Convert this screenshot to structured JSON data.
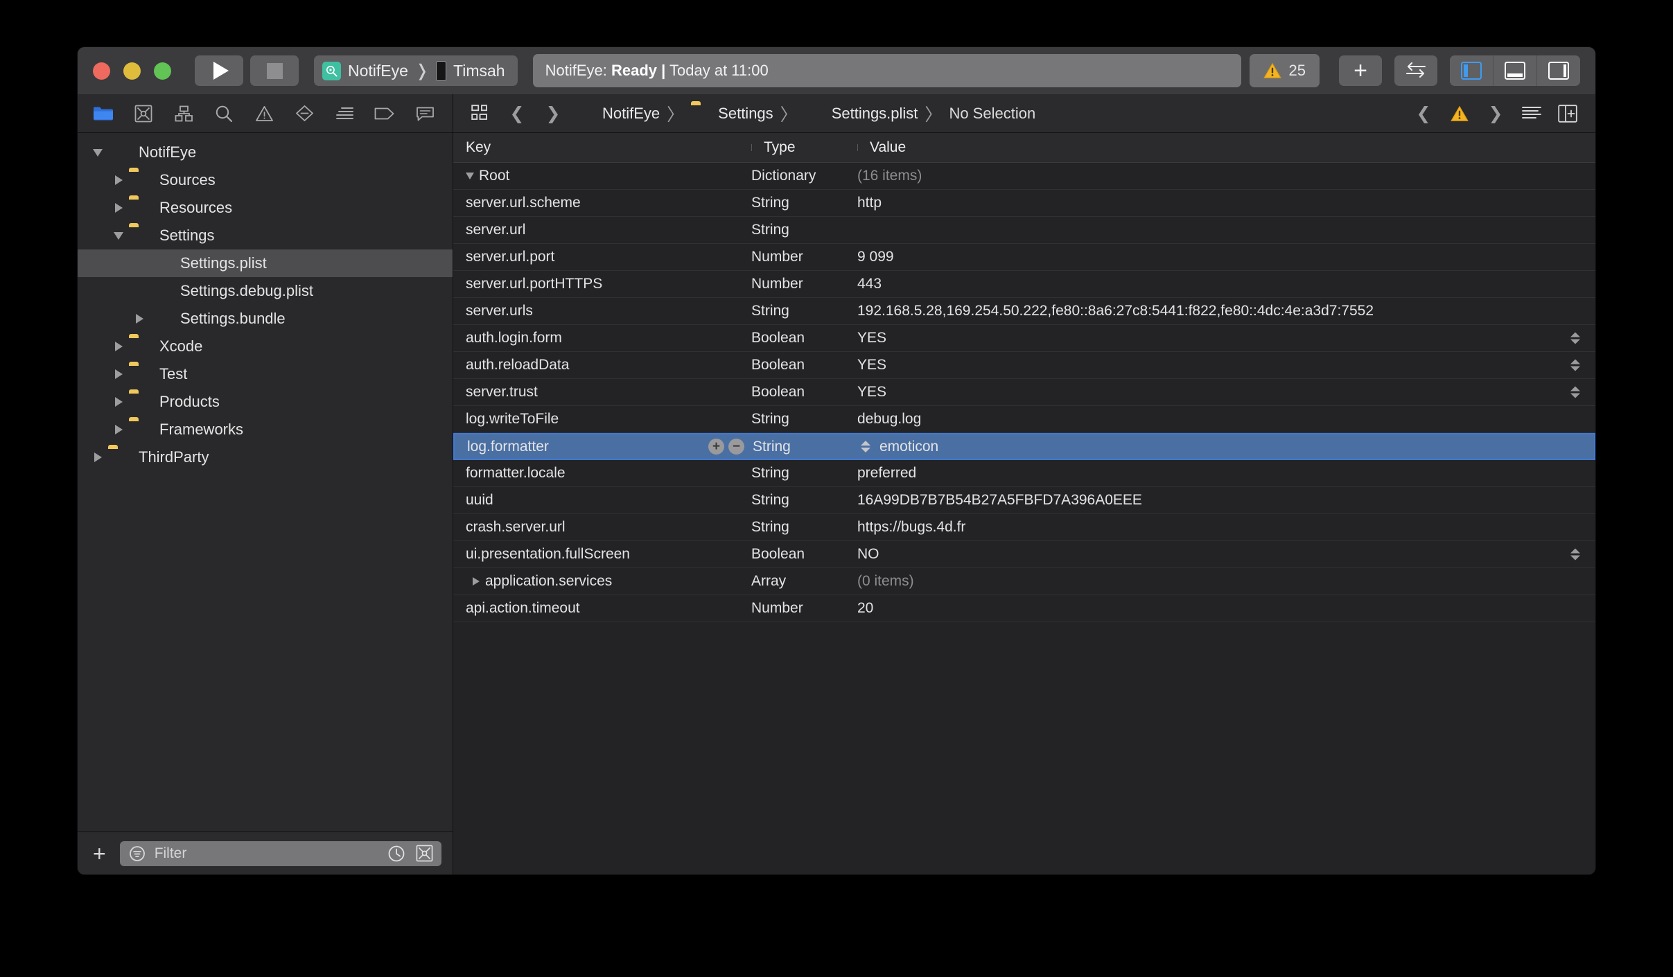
{
  "window": {
    "traffic_lights": [
      "close",
      "minimize",
      "zoom"
    ],
    "colors": {
      "close": "#ee6a5f",
      "minimize": "#e0bc3c",
      "zoom": "#61c454",
      "accent": "#3f79d4",
      "warning": "#f3b322",
      "selection": "#4a6fa3"
    }
  },
  "toolbar": {
    "run_label": "Run",
    "stop_label": "Stop",
    "scheme_name": "NotifEye",
    "destination_name": "Timsah",
    "status_prefix": "NotifEye: ",
    "status_state": "Ready |",
    "status_suffix": " Today at 11:00",
    "warning_count": "25",
    "add_label": "+",
    "toggle_label": "Toggle",
    "panel_left_label": "Navigator",
    "panel_bottom_label": "Debug Area",
    "panel_right_label": "Inspector"
  },
  "navigator": {
    "tabs": [
      {
        "name": "project-navigator",
        "icon": "folder-icon",
        "active": true
      },
      {
        "name": "source-control-navigator",
        "icon": "source-control-icon",
        "active": false
      },
      {
        "name": "symbol-navigator",
        "icon": "hierarchy-icon",
        "active": false
      },
      {
        "name": "find-navigator",
        "icon": "search-icon",
        "active": false
      },
      {
        "name": "issue-navigator",
        "icon": "warning-triangle-icon",
        "active": false
      },
      {
        "name": "test-navigator",
        "icon": "diamond-minus-icon",
        "active": false
      },
      {
        "name": "debug-navigator",
        "icon": "lines-icon",
        "active": false
      },
      {
        "name": "breakpoint-navigator",
        "icon": "tag-icon",
        "active": false
      },
      {
        "name": "report-navigator",
        "icon": "speech-bubble-icon",
        "active": false
      }
    ],
    "tree": [
      {
        "label": "NotifEye",
        "icon": "xcode-project-icon",
        "depth": 0,
        "twisty": "open",
        "selected": false
      },
      {
        "label": "Sources",
        "icon": "folder-icon",
        "depth": 1,
        "twisty": "closed",
        "selected": false
      },
      {
        "label": "Resources",
        "icon": "folder-icon",
        "depth": 1,
        "twisty": "closed",
        "selected": false
      },
      {
        "label": "Settings",
        "icon": "folder-icon",
        "depth": 1,
        "twisty": "open",
        "selected": false
      },
      {
        "label": "Settings.plist",
        "icon": "plist-file-icon",
        "depth": 2,
        "twisty": "none",
        "selected": true
      },
      {
        "label": "Settings.debug.plist",
        "icon": "plist-file-icon",
        "depth": 2,
        "twisty": "none",
        "selected": false
      },
      {
        "label": "Settings.bundle",
        "icon": "bundle-icon",
        "depth": 2,
        "twisty": "closed",
        "selected": false
      },
      {
        "label": "Xcode",
        "icon": "folder-icon",
        "depth": 1,
        "twisty": "closed",
        "selected": false
      },
      {
        "label": "Test",
        "icon": "folder-icon",
        "depth": 1,
        "twisty": "closed",
        "selected": false
      },
      {
        "label": "Products",
        "icon": "folder-icon",
        "depth": 1,
        "twisty": "closed",
        "selected": false
      },
      {
        "label": "Frameworks",
        "icon": "folder-icon",
        "depth": 1,
        "twisty": "closed",
        "selected": false
      },
      {
        "label": "ThirdParty",
        "icon": "folder-icon",
        "depth": 0,
        "twisty": "closed",
        "selected": false
      }
    ],
    "filter": {
      "add_label": "+",
      "placeholder": "Filter",
      "value": "",
      "recents_icon": "clock-icon",
      "scm_icon": "source-control-icon"
    }
  },
  "editor": {
    "breadcrumb": [
      {
        "label": "NotifEye",
        "icon": "xcode-project-icon"
      },
      {
        "label": "Settings",
        "icon": "folder-icon"
      },
      {
        "label": "Settings.plist",
        "icon": "plist-file-icon"
      },
      {
        "label": "No Selection",
        "icon": "none"
      }
    ],
    "separator": "〉",
    "right_controls": {
      "prev_issue": "‹",
      "issue_icon": "warning-triangle-icon",
      "next_issue": "›",
      "minimap_icon": "lines-icon",
      "split_icon": "add-editor-icon"
    },
    "table": {
      "columns": [
        "Key",
        "Type",
        "Value"
      ],
      "rows": [
        {
          "key": "Root",
          "type": "Dictionary",
          "value": "(16 items)",
          "depth": 0,
          "twisty": "open",
          "value_style": "dim",
          "selected": false,
          "stepper": false
        },
        {
          "key": "server.url.scheme",
          "type": "String",
          "value": "http",
          "depth": 1,
          "twisty": "none",
          "value_style": "normal",
          "selected": false,
          "stepper": false
        },
        {
          "key": "server.url",
          "type": "String",
          "value": "",
          "depth": 1,
          "twisty": "none",
          "value_style": "normal",
          "selected": false,
          "stepper": false
        },
        {
          "key": "server.url.port",
          "type": "Number",
          "value": "9 099",
          "depth": 1,
          "twisty": "none",
          "value_style": "normal",
          "selected": false,
          "stepper": false
        },
        {
          "key": "server.url.portHTTPS",
          "type": "Number",
          "value": "443",
          "depth": 1,
          "twisty": "none",
          "value_style": "normal",
          "selected": false,
          "stepper": false
        },
        {
          "key": "server.urls",
          "type": "String",
          "value": "192.168.5.28,169.254.50.222,fe80::8a6:27c8:5441:f822,fe80::4dc:4e:a3d7:7552",
          "depth": 1,
          "twisty": "none",
          "value_style": "normal",
          "selected": false,
          "stepper": false
        },
        {
          "key": "auth.login.form",
          "type": "Boolean",
          "value": "YES",
          "depth": 1,
          "twisty": "none",
          "value_style": "normal",
          "selected": false,
          "stepper": true
        },
        {
          "key": "auth.reloadData",
          "type": "Boolean",
          "value": "YES",
          "depth": 1,
          "twisty": "none",
          "value_style": "normal",
          "selected": false,
          "stepper": true
        },
        {
          "key": "server.trust",
          "type": "Boolean",
          "value": "YES",
          "depth": 1,
          "twisty": "none",
          "value_style": "normal",
          "selected": false,
          "stepper": true
        },
        {
          "key": "log.writeToFile",
          "type": "String",
          "value": "debug.log",
          "depth": 1,
          "twisty": "none",
          "value_style": "normal",
          "selected": false,
          "stepper": false
        },
        {
          "key": "log.formatter",
          "type": "String",
          "value": "emoticon",
          "depth": 1,
          "twisty": "none",
          "value_style": "normal",
          "selected": true,
          "stepper": false
        },
        {
          "key": "formatter.locale",
          "type": "String",
          "value": "preferred",
          "depth": 1,
          "twisty": "none",
          "value_style": "normal",
          "selected": false,
          "stepper": false
        },
        {
          "key": "uuid",
          "type": "String",
          "value": "16A99DB7B7B54B27A5FBFD7A396A0EEE",
          "depth": 1,
          "twisty": "none",
          "value_style": "normal",
          "selected": false,
          "stepper": false
        },
        {
          "key": "crash.server.url",
          "type": "String",
          "value": "https://bugs.4d.fr",
          "depth": 1,
          "twisty": "none",
          "value_style": "normal",
          "selected": false,
          "stepper": false
        },
        {
          "key": "ui.presentation.fullScreen",
          "type": "Boolean",
          "value": "NO",
          "depth": 1,
          "twisty": "none",
          "value_style": "normal",
          "selected": false,
          "stepper": true
        },
        {
          "key": "application.services",
          "type": "Array",
          "value": "(0 items)",
          "depth": 1,
          "twisty": "closed",
          "value_style": "dim",
          "selected": false,
          "stepper": false
        },
        {
          "key": "api.action.timeout",
          "type": "Number",
          "value": "20",
          "depth": 1,
          "twisty": "none",
          "value_style": "normal",
          "selected": false,
          "stepper": false
        }
      ],
      "selected_row_controls": {
        "add": "+",
        "remove": "−"
      }
    }
  }
}
